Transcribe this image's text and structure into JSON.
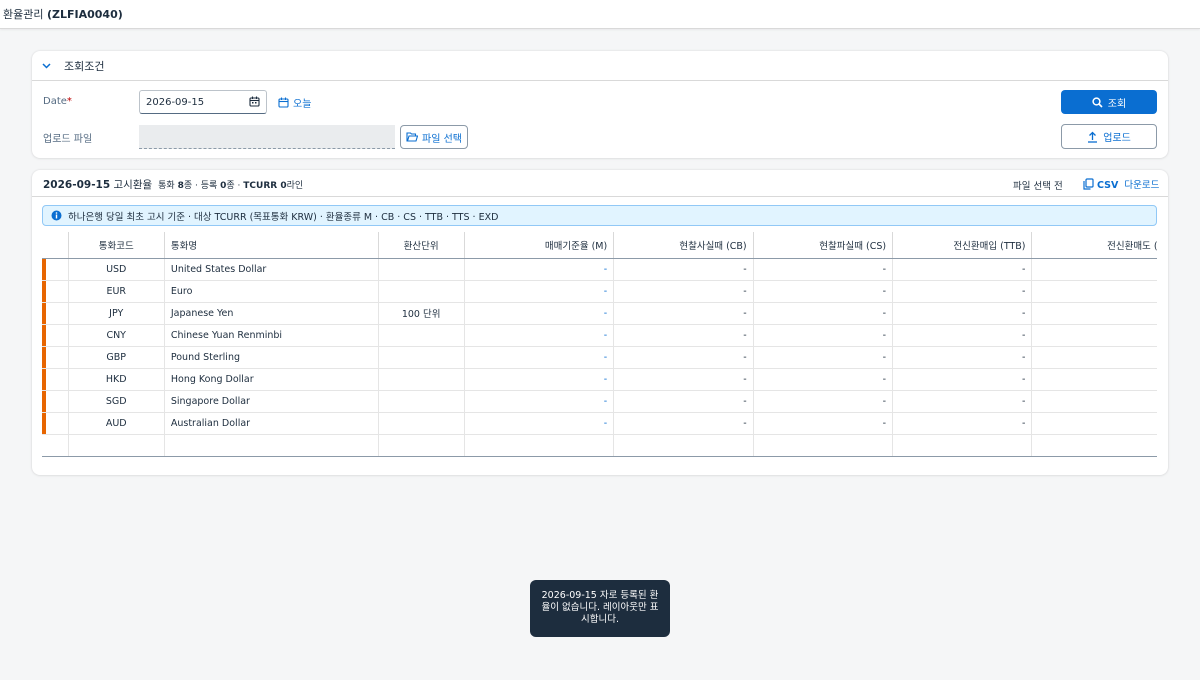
{
  "app": {
    "title_prefix": "환율관리 ",
    "title_code": "(ZLFIA0040)"
  },
  "filter": {
    "header": "조회조건",
    "date_label": "Date",
    "required_mark": "*",
    "date_value": "2026-09-15",
    "today_label": "오늘",
    "upload_label": "업로드 파일",
    "file_select_label": "파일 선택",
    "search_label": "조회",
    "upload_button_label": "업로드"
  },
  "table": {
    "title_date": "2026-09-15",
    "title_text": " 고시환율",
    "meta_prefix": "통화 ",
    "meta_currency_count": "8",
    "meta_mid1": "종 · 등록 ",
    "meta_registered": "0",
    "meta_mid2": "종 · ",
    "meta_tcurr": "TCURR 0",
    "meta_suffix": "라인",
    "file_status": "파일 선택 전",
    "csv_bold": "CSV",
    "csv_rest": " 다운로드",
    "info": "하나은행 당일 최초 고시 기준 · 대상 TCURR (목표통화 KRW) · 환율종류 M · CB · CS · TTB · TTS · EXD",
    "columns": [
      "통화코드",
      "통화명",
      "환산단위",
      "매매기준율 (M)",
      "현찰사실때 (CB)",
      "현찰파실때 (CS)",
      "전신환매입 (TTB)",
      "전신환매도 (TTS"
    ],
    "rows": [
      {
        "code": "USD",
        "name": "United States Dollar",
        "unit": "",
        "m": "-",
        "cb": "-",
        "cs": "-",
        "ttb": "-",
        "tts": ""
      },
      {
        "code": "EUR",
        "name": "Euro",
        "unit": "",
        "m": "-",
        "cb": "-",
        "cs": "-",
        "ttb": "-",
        "tts": ""
      },
      {
        "code": "JPY",
        "name": "Japanese Yen",
        "unit": "100 단위",
        "m": "-",
        "cb": "-",
        "cs": "-",
        "ttb": "-",
        "tts": ""
      },
      {
        "code": "CNY",
        "name": "Chinese Yuan Renminbi",
        "unit": "",
        "m": "-",
        "cb": "-",
        "cs": "-",
        "ttb": "-",
        "tts": ""
      },
      {
        "code": "GBP",
        "name": "Pound Sterling",
        "unit": "",
        "m": "-",
        "cb": "-",
        "cs": "-",
        "ttb": "-",
        "tts": ""
      },
      {
        "code": "HKD",
        "name": "Hong Kong Dollar",
        "unit": "",
        "m": "-",
        "cb": "-",
        "cs": "-",
        "ttb": "-",
        "tts": ""
      },
      {
        "code": "SGD",
        "name": "Singapore Dollar",
        "unit": "",
        "m": "-",
        "cb": "-",
        "cs": "-",
        "ttb": "-",
        "tts": ""
      },
      {
        "code": "AUD",
        "name": "Australian Dollar",
        "unit": "",
        "m": "-",
        "cb": "-",
        "cs": "-",
        "ttb": "-",
        "tts": ""
      }
    ]
  },
  "toast": {
    "message": "2026-09-15 자로 등록된 환율이 없습니다. 레이아웃만 표시합니다."
  },
  "colors": {
    "accent": "#0a6ed1",
    "row_marker": "#e76500",
    "toast_bg": "#1d2d3e",
    "info_bg": "#e1f4ff"
  },
  "icons": {
    "collapse": "chevron-down-icon",
    "date": "calendar-icon",
    "today": "calendar-icon",
    "file": "folder-open-icon",
    "search": "search-icon",
    "upload": "upload-icon",
    "csv": "copy-icon",
    "info": "info-icon"
  }
}
